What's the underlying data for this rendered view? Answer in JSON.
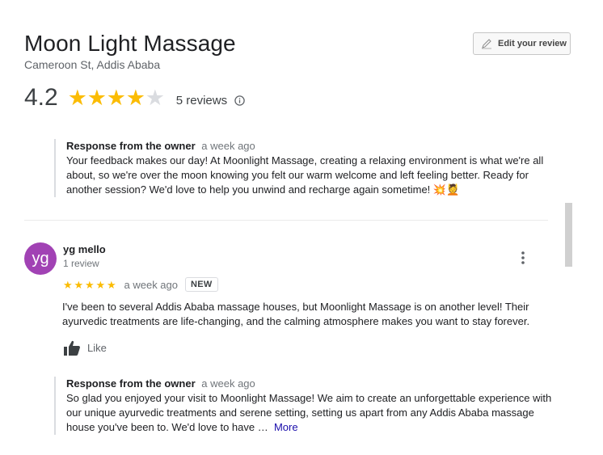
{
  "business": {
    "name": "Moon Light Massage",
    "address": "Cameroon St, Addis Ababa",
    "rating": "4.2",
    "stars_filled": 4,
    "stars_total": 5,
    "reviews_count": "5 reviews"
  },
  "edit_review": {
    "label": "Edit your review"
  },
  "response_1": {
    "label": "Response from the owner",
    "time": "a week ago",
    "text": "Your feedback makes our day! At Moonlight Massage, creating a relaxing environment is what we're all about, so we're over the moon knowing you felt our warm welcome and left feeling better. Ready for another session? We'd love to help you unwind and recharge again sometime! 💥💆"
  },
  "review": {
    "avatar_initials": "yg",
    "avatar_color": "#a142b4",
    "reviewer_name": "yg mello",
    "reviewer_meta": "1 review",
    "stars": "★★★★★",
    "time": "a week ago",
    "badge": "NEW",
    "text": "I've been to several Addis Ababa massage houses, but Moonlight Massage is on another level! Their ayurvedic treatments are life-changing, and the calming atmosphere makes you want to stay forever.",
    "like_label": "Like"
  },
  "response_2": {
    "label": "Response from the owner",
    "time": "a week ago",
    "text": "So glad you enjoyed your visit to Moonlight Massage! We aim to create an unforgettable experience with our unique ayurvedic treatments and serene setting, setting us apart from any Addis Ababa massage house you've been to. We'd love to have …",
    "more_label": "More"
  },
  "icons": {
    "edit": "pencil-icon",
    "info": "info-icon",
    "more": "more-vert-icon",
    "like": "thumb-up-icon"
  },
  "colors": {
    "star": "#fbbc04",
    "star_empty": "#dadce0",
    "link": "#1a0dab"
  }
}
